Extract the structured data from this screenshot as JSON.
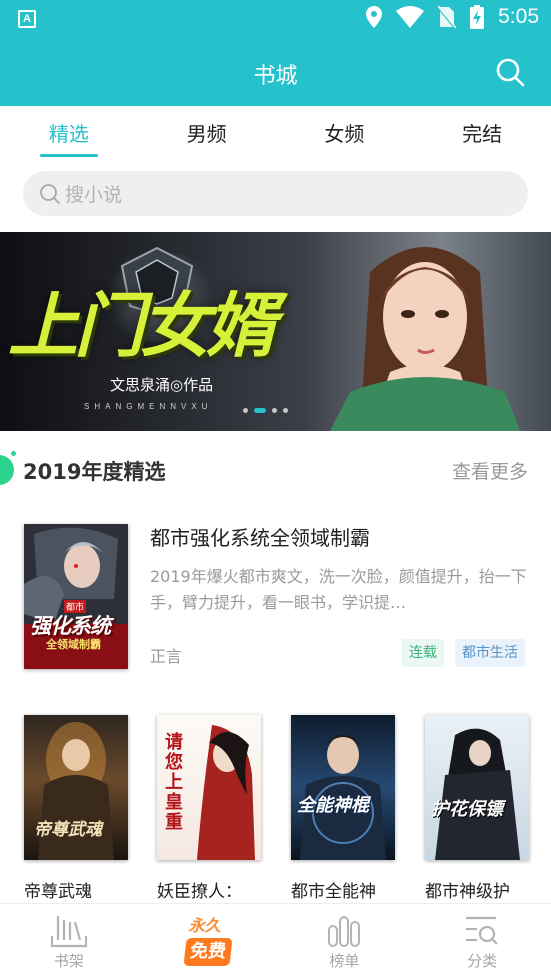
{
  "status_bar": {
    "app_badge": "A",
    "time": "5:05",
    "icons": [
      "location-icon",
      "wifi-icon",
      "no-sim-icon",
      "battery-charging-icon"
    ]
  },
  "header": {
    "title": "书城",
    "search_icon": "search-icon"
  },
  "tabs": [
    {
      "label": "精选",
      "active": true
    },
    {
      "label": "男频",
      "active": false
    },
    {
      "label": "女频",
      "active": false
    },
    {
      "label": "完结",
      "active": false
    }
  ],
  "search": {
    "placeholder": "搜小说"
  },
  "banner": {
    "headline": "上门女婿",
    "author_line": "文思泉涌◎作品",
    "pinyin": "SHANGMENNVXU",
    "dots_total": 4,
    "dots_active_index": 1
  },
  "section": {
    "title": "2019年度精选",
    "more": "查看更多"
  },
  "featured_book": {
    "title": "都市强化系统全领域制霸",
    "description": "2019年爆火都市爽文，洗一次脸，颜值提升，抬一下手，臂力提升，看一眼书，学识提…",
    "author": "正言",
    "tags": [
      "连载",
      "都市生活"
    ],
    "cover_text": {
      "tag": "都市",
      "main": "强化系统",
      "sub": "全领域制霸"
    }
  },
  "grid_books": [
    {
      "name": "帝尊武魂",
      "cover_text": "帝尊武魂"
    },
    {
      "name": "妖臣撩人：",
      "cover_text": "请您上皇重"
    },
    {
      "name": "都市全能神",
      "cover_text": "全能神棍"
    },
    {
      "name": "都市神级护",
      "cover_text": "护花保镖"
    }
  ],
  "bottom_nav": [
    {
      "label": "书架",
      "icon": "bookshelf-icon"
    },
    {
      "label": "",
      "icon": "free-badge-icon",
      "badge_top": "永久",
      "badge_bottom": "免费"
    },
    {
      "label": "榜单",
      "icon": "ranking-icon"
    },
    {
      "label": "分类",
      "icon": "category-icon"
    }
  ]
}
